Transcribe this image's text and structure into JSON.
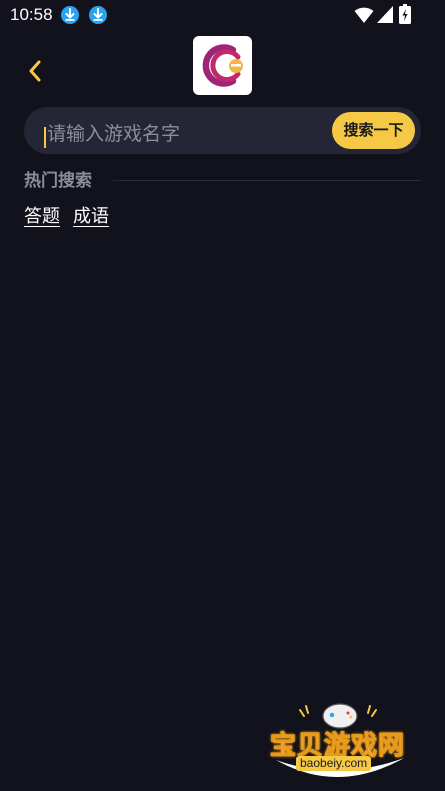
{
  "status_bar": {
    "time": "10:58"
  },
  "header": {
    "back_icon": "chevron-left-icon",
    "logo": "app-logo"
  },
  "search": {
    "placeholder": "请输入游戏名字",
    "value": "",
    "button_label": "搜索一下"
  },
  "hot_search": {
    "title": "热门搜索",
    "tags": [
      "答题",
      "成语"
    ]
  },
  "watermark": {
    "text": "宝贝游戏网",
    "url": "baobeiy.com"
  },
  "colors": {
    "background": "#12121c",
    "accent": "#f5c945",
    "search_bg": "#242636",
    "muted_text": "#8a8d9c"
  }
}
